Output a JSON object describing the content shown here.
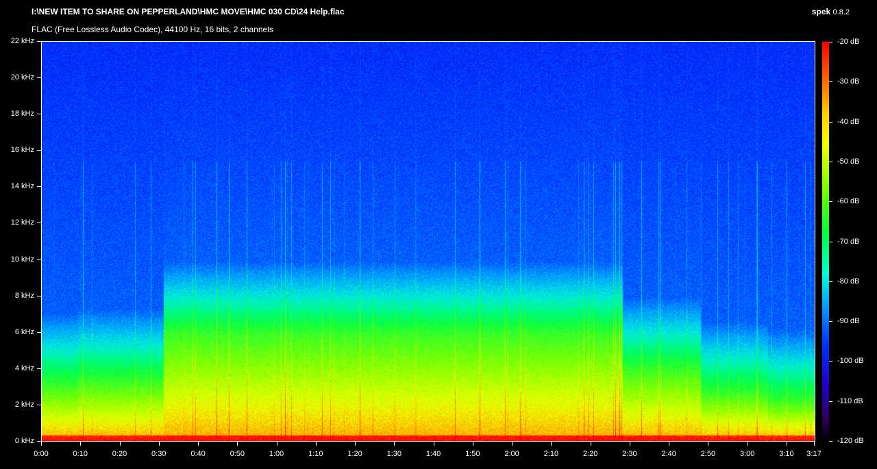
{
  "header": {
    "file_path": "I:\\NEW ITEM TO SHARE ON PEPPERLAND\\HMC MOVE\\HMC 030 CD\\24 Help.flac",
    "format_info": "FLAC (Free Lossless Audio Codec), 44100 Hz, 16 bits, 2 channels",
    "app_name": "spek",
    "app_version": "0.8.2"
  },
  "frequency_axis": {
    "labels": [
      "22 kHz",
      "20 kHz",
      "18 kHz",
      "16 kHz",
      "14 kHz",
      "12 kHz",
      "10 kHz",
      "8 kHz",
      "6 kHz",
      "4 kHz",
      "2 kHz",
      "0 kHz"
    ],
    "max_khz": 22
  },
  "time_axis": {
    "labels": [
      "0:00",
      "0:10",
      "0:20",
      "0:30",
      "0:40",
      "0:50",
      "1:00",
      "1:10",
      "1:20",
      "1:30",
      "1:40",
      "1:50",
      "2:00",
      "2:10",
      "2:20",
      "2:30",
      "2:40",
      "2:50",
      "3:00",
      "3:10",
      "3:17"
    ],
    "duration_seconds": 197
  },
  "db_scale": {
    "labels": [
      "-20 dB",
      "-30 dB",
      "-40 dB",
      "-50 dB",
      "-60 dB",
      "-70 dB",
      "-80 dB",
      "-90 dB",
      "-100 dB",
      "-110 dB",
      "-120 dB"
    ],
    "max_db": -20,
    "min_db": -120
  }
}
